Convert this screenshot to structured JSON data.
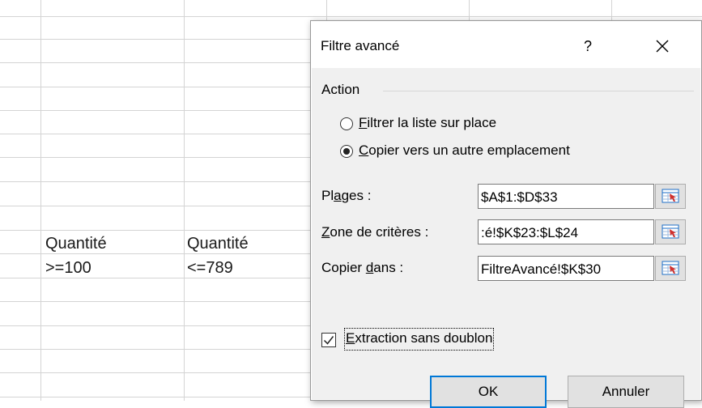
{
  "sheet": {
    "criteria": [
      {
        "header": "Quantité",
        "value": ">=100"
      },
      {
        "header": "Quantité",
        "value": "<=789"
      }
    ]
  },
  "dialog": {
    "title": "Filtre avancé",
    "help": "?",
    "action_label": "Action",
    "radio_filter": {
      "mnemonic": "F",
      "rest": "iltrer la liste sur place",
      "selected": false
    },
    "radio_copy": {
      "mnemonic": "C",
      "rest": "opier vers un autre emplacement",
      "selected": true
    },
    "range_label": {
      "before": "Pl",
      "mnemonic": "a",
      "after": "ges :"
    },
    "range_value": "$A$1:$D$33",
    "criteria_label": {
      "mnemonic": "Z",
      "after": "one de critères :"
    },
    "criteria_value": ":é!$K$23:$L$24",
    "copy_label": {
      "before": "Copier ",
      "mnemonic": "d",
      "after": "ans :"
    },
    "copy_value": "FiltreAvancé!$K$30",
    "unique_checkbox": {
      "mnemonic": "E",
      "rest": "xtraction sans doublon",
      "checked": true
    },
    "ok_label": "OK",
    "cancel_label": "Annuler"
  },
  "colors": {
    "grid": "#d4d4d4",
    "dialog_bg": "#f0f0f0",
    "button_bg": "#e1e1e1",
    "default_button_border": "#0078d7",
    "picker_icon_red": "#d0312d",
    "picker_icon_blue": "#1e6fc8"
  },
  "icons": [
    "close-icon",
    "range-picker-icon",
    "check-icon"
  ]
}
